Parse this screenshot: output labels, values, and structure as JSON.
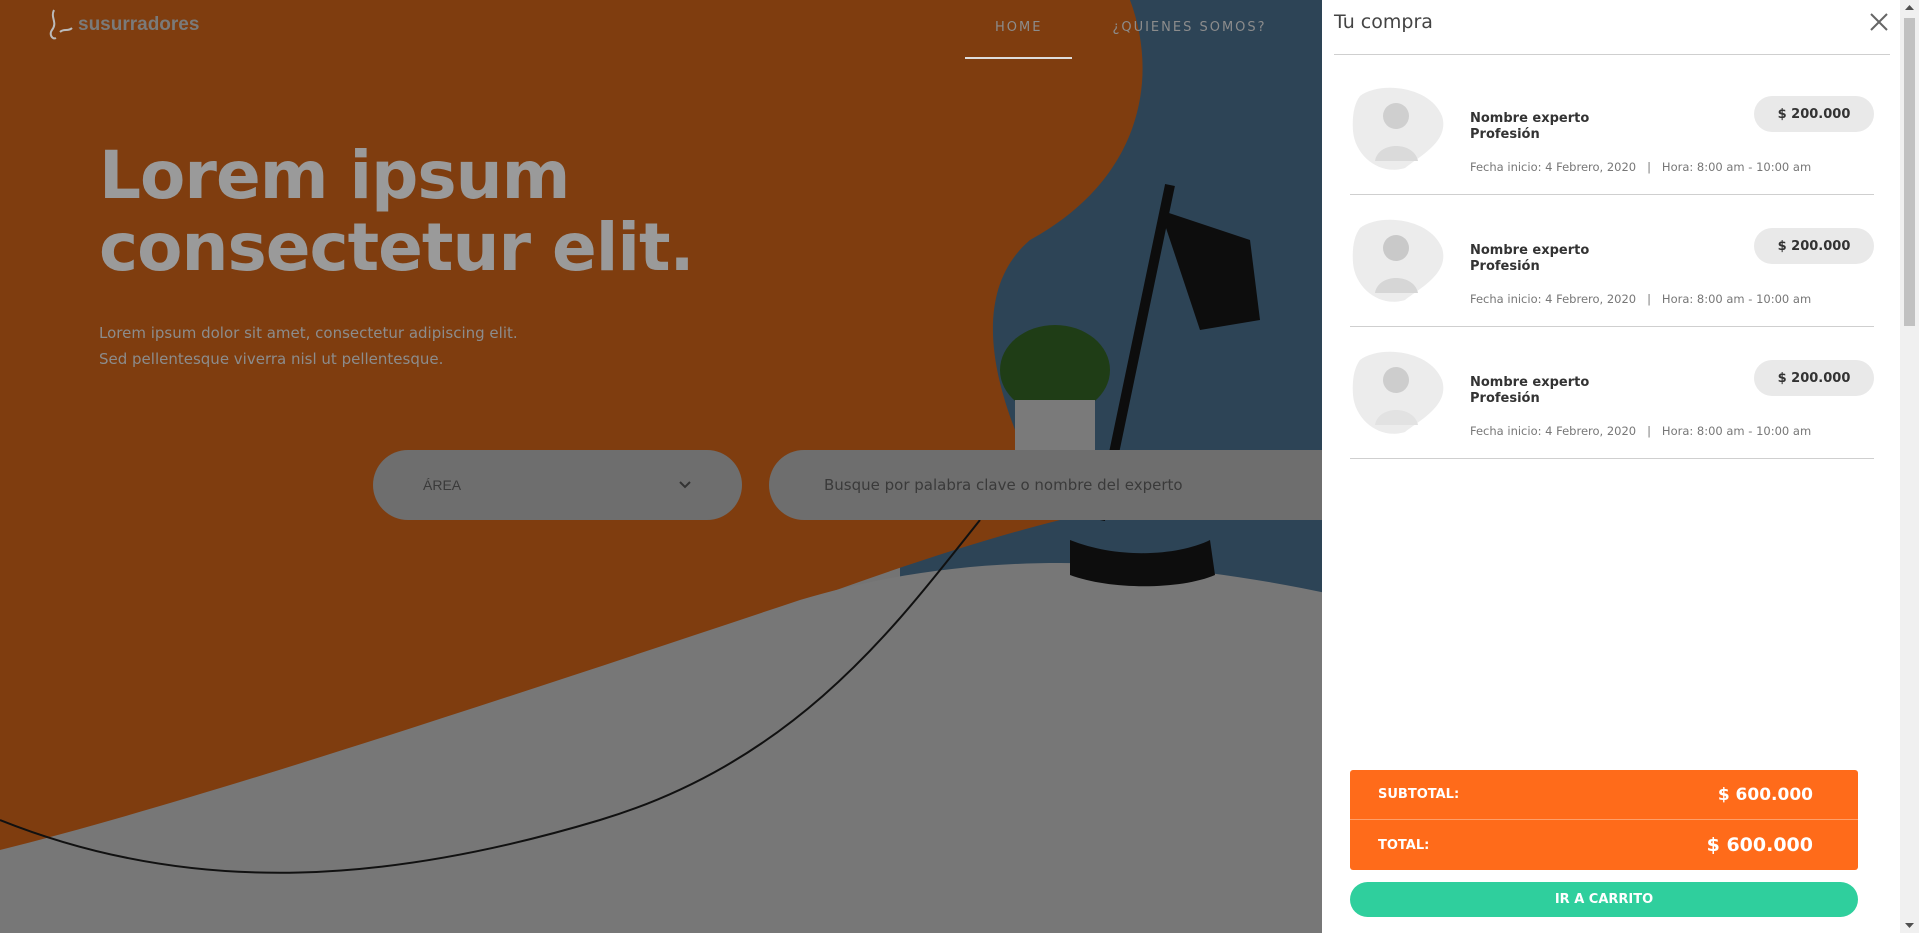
{
  "brand": {
    "logo_text": "susurradores"
  },
  "nav": {
    "items": [
      {
        "label": "HOME"
      },
      {
        "label": "¿QUIENES SOMOS?"
      }
    ]
  },
  "hero": {
    "title_line1": "Lorem ipsum",
    "title_line2": "consectetur elit.",
    "subtitle_line1": "Lorem ipsum dolor sit amet, consectetur adipiscing elit.",
    "subtitle_line2": "Sed pellentesque viverra nisl ut pellentesque."
  },
  "search": {
    "area_label": "ÁREA",
    "keyword_placeholder": "Busque por palabra clave o nombre del experto"
  },
  "cart_panel": {
    "title": "Tu compra",
    "items": [
      {
        "name": "Nombre experto",
        "profession": "Profesión",
        "price": "$ 200.000",
        "meta": "Fecha inicio: 4 Febrero, 2020   |   Hora: 8:00 am - 10:00 am"
      },
      {
        "name": "Nombre experto",
        "profession": "Profesión",
        "price": "$ 200.000",
        "meta": "Fecha inicio: 4 Febrero, 2020   |   Hora: 8:00 am - 10:00 am"
      },
      {
        "name": "Nombre experto",
        "profession": "Profesión",
        "price": "$ 200.000",
        "meta": "Fecha inicio: 4 Febrero, 2020   |   Hora: 8:00 am - 10:00 am"
      }
    ],
    "subtotal_label": "SUBTOTAL:",
    "subtotal_value": "$ 600.000",
    "total_label": "TOTAL:",
    "total_value": "$ 600.000",
    "cta_label": "IR A CARRITO"
  },
  "colors": {
    "accent_orange": "#ff6b1a",
    "cta_green": "#2fcf9d",
    "overlay": "rgba(0,0,0,0.5)"
  },
  "icons": {
    "close": "close-icon",
    "chevron": "chevron-down-icon"
  }
}
